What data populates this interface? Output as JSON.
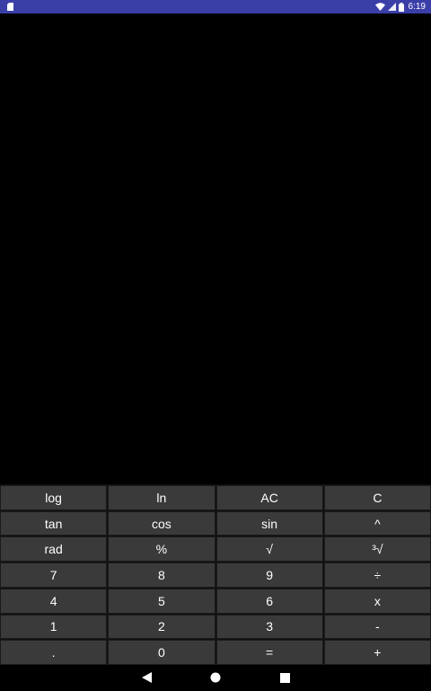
{
  "status_bar": {
    "time": "6:19",
    "color": "#3a3fa8"
  },
  "keypad": {
    "keys": [
      {
        "label": "log",
        "name": "key-log"
      },
      {
        "label": "ln",
        "name": "key-ln"
      },
      {
        "label": "AC",
        "name": "key-all-clear"
      },
      {
        "label": "C",
        "name": "key-clear"
      },
      {
        "label": "tan",
        "name": "key-tan"
      },
      {
        "label": "cos",
        "name": "key-cos"
      },
      {
        "label": "sin",
        "name": "key-sin"
      },
      {
        "label": "^",
        "name": "key-power"
      },
      {
        "label": "rad",
        "name": "key-rad"
      },
      {
        "label": "%",
        "name": "key-percent"
      },
      {
        "label": "√",
        "name": "key-sqrt"
      },
      {
        "label": "³√",
        "name": "key-cube-root"
      },
      {
        "label": "7",
        "name": "key-7"
      },
      {
        "label": "8",
        "name": "key-8"
      },
      {
        "label": "9",
        "name": "key-9"
      },
      {
        "label": "÷",
        "name": "key-divide"
      },
      {
        "label": "4",
        "name": "key-4"
      },
      {
        "label": "5",
        "name": "key-5"
      },
      {
        "label": "6",
        "name": "key-6"
      },
      {
        "label": "x",
        "name": "key-multiply"
      },
      {
        "label": "1",
        "name": "key-1"
      },
      {
        "label": "2",
        "name": "key-2"
      },
      {
        "label": "3",
        "name": "key-3"
      },
      {
        "label": "-",
        "name": "key-minus"
      },
      {
        "label": ".",
        "name": "key-decimal"
      },
      {
        "label": "0",
        "name": "key-0"
      },
      {
        "label": "=",
        "name": "key-equals"
      },
      {
        "label": "+",
        "name": "key-plus"
      }
    ]
  },
  "nav_bar": {
    "icons": [
      "back-icon",
      "home-icon",
      "recent-apps-icon"
    ]
  }
}
